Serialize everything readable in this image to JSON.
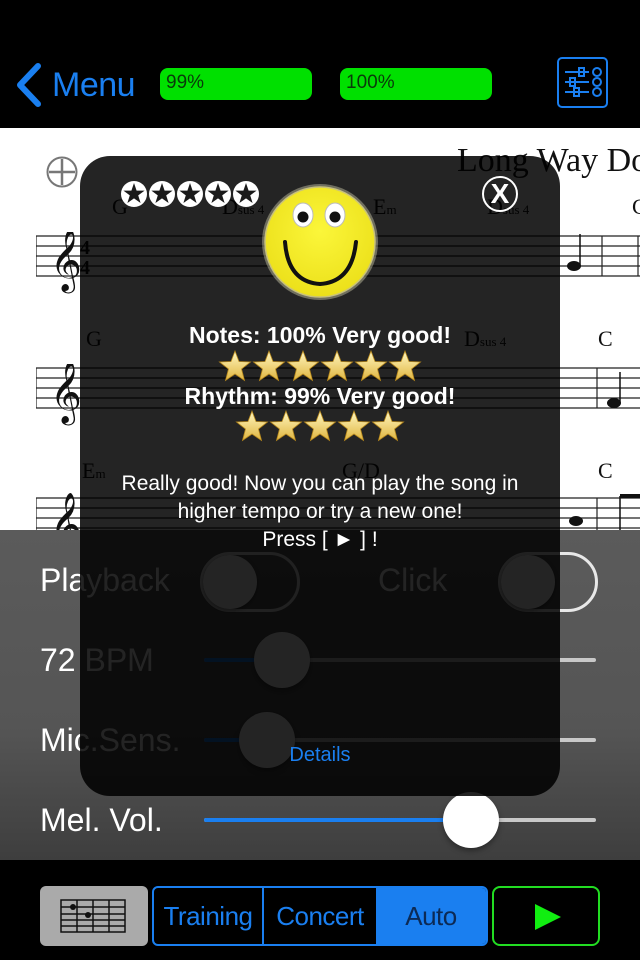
{
  "topbar": {
    "back_label": "Menu",
    "progress_1": {
      "label": "99%",
      "value": 99
    },
    "progress_2": {
      "label": "100%",
      "value": 100
    },
    "settings_icon": "sliders-icon"
  },
  "sheet": {
    "title": "Long Way Do",
    "chords_row1": [
      {
        "root": "G",
        "suffix": ""
      },
      {
        "root": "D",
        "suffix": "sus 4"
      },
      {
        "root": "E",
        "suffix": "m"
      },
      {
        "root": "D",
        "suffix": "sus 4"
      },
      {
        "root": "C",
        "suffix": ""
      }
    ],
    "chords_row2": [
      {
        "root": "G",
        "suffix": ""
      },
      {
        "root": "D",
        "suffix": "sus 4"
      },
      {
        "root": "C",
        "suffix": ""
      }
    ],
    "chords_row3": [
      {
        "root": "E",
        "suffix": "m"
      },
      {
        "root": "G/D",
        "suffix": ""
      },
      {
        "root": "C",
        "suffix": ""
      }
    ],
    "time_signature": "4/4"
  },
  "controls": {
    "playback": {
      "label": "Playback",
      "on": false
    },
    "click": {
      "label": "Click",
      "on": false
    },
    "tempo": {
      "label": "72 BPM",
      "value_fraction": 0.2
    },
    "mic": {
      "label": "Mic.Sens.",
      "value_fraction": 0.16
    },
    "melody": {
      "label": "Mel. Vol.",
      "value_fraction": 0.68
    }
  },
  "bottombar": {
    "chord_view_icon": "chord-grid-icon",
    "modes": [
      "Training",
      "Concert",
      "Auto"
    ],
    "selected_mode": "Auto",
    "play_icon": "play-icon"
  },
  "result": {
    "rating_circles": 5,
    "notes_line": "Notes: 100% Very good!",
    "notes_stars": 6,
    "rhythm_line": "Rhythm: 99% Very good!",
    "rhythm_stars": 5,
    "message": "Really good! Now you can play the song in higher tempo or try a new one!",
    "press_line": "Press [ ► ]  !",
    "details_label": "Details",
    "close_label": "X"
  },
  "colors": {
    "accent": "#1a7ff0",
    "progress_green": "#00e000",
    "play_green": "#22dd22",
    "smiley_yellow": "#f5ee1a"
  }
}
